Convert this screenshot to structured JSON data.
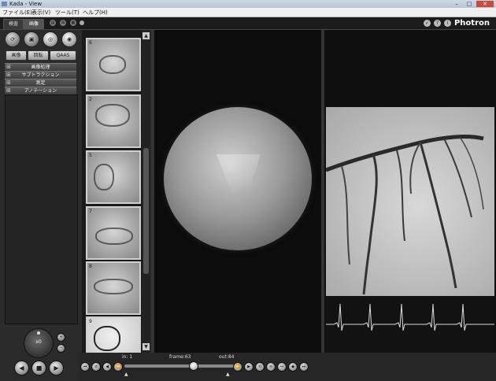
{
  "window": {
    "title": "Kada - View"
  },
  "menu": [
    "ファイル(E)",
    "表示(V)",
    "ツール(T)",
    "ヘルプ(H)"
  ],
  "topstrip": {
    "tabs": [
      "検査",
      "画像"
    ],
    "brand": "Photron"
  },
  "left": {
    "subtabs": [
      "画像",
      "回転",
      "QAAS"
    ],
    "accordion": [
      "画像処理",
      "サブトラクション",
      "測定",
      "アノテーション"
    ],
    "zoom": "x0"
  },
  "thumbnails": [
    "6",
    "2",
    "5",
    "7",
    "8",
    "9"
  ],
  "transport": {
    "in_label": "in: 1",
    "frame_label": "frame:63",
    "out_label": "out:84"
  },
  "colors": {
    "background": "#2a2a2a",
    "viewer": "#0c0c0c"
  }
}
